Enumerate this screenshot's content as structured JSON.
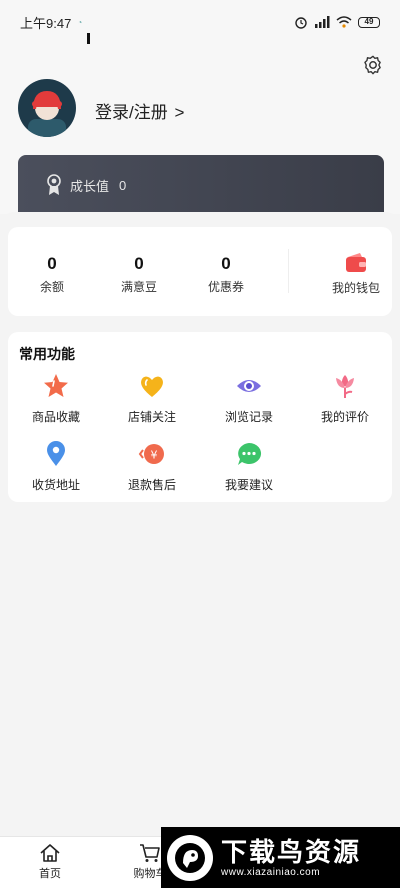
{
  "status_bar": {
    "time": "上午9:47",
    "battery": "49"
  },
  "profile": {
    "login_label": "登录/注册",
    "chevron": ">"
  },
  "growth": {
    "label": "成长值",
    "value": "0"
  },
  "wallet": {
    "stats": [
      {
        "value": "0",
        "label": "余额"
      },
      {
        "value": "0",
        "label": "满意豆"
      },
      {
        "value": "0",
        "label": "优惠券"
      }
    ],
    "my_wallet_label": "我的钱包"
  },
  "functions": {
    "title": "常用功能",
    "items": [
      {
        "label": "商品收藏",
        "icon": "star-icon"
      },
      {
        "label": "店铺关注",
        "icon": "heart-icon"
      },
      {
        "label": "浏览记录",
        "icon": "eye-icon"
      },
      {
        "label": "我的评价",
        "icon": "flower-icon"
      },
      {
        "label": "收货地址",
        "icon": "location-pin-icon"
      },
      {
        "label": "退款售后",
        "icon": "refund-icon"
      },
      {
        "label": "我要建议",
        "icon": "chat-bubble-icon"
      }
    ]
  },
  "tabs": [
    {
      "label": "首页",
      "icon": "home-icon"
    },
    {
      "label": "购物车",
      "icon": "cart-icon"
    }
  ],
  "watermark": {
    "title": "下载鸟资源",
    "url": "www.xiazainiao.com"
  }
}
